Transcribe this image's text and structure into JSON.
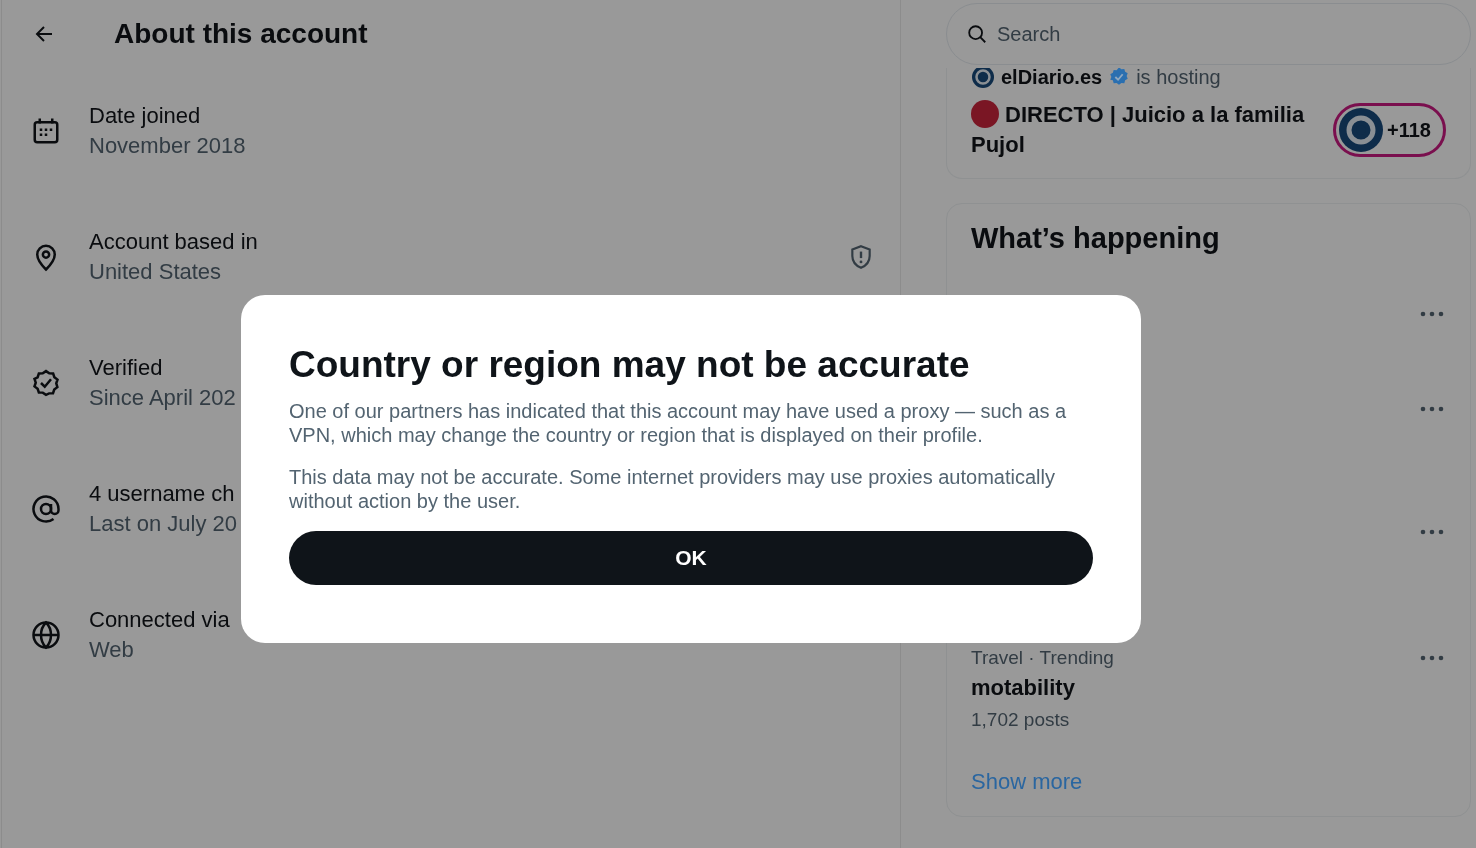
{
  "header": {
    "title": "About this account"
  },
  "details": [
    {
      "kind": "calendar",
      "label": "Date joined",
      "value": "November 2018"
    },
    {
      "kind": "location",
      "label": "Account based in",
      "value": "United States",
      "shield": true
    },
    {
      "kind": "verified",
      "label": "Verified",
      "value": "Since April 202"
    },
    {
      "kind": "at",
      "label": "4 username ch",
      "value": "Last on July 20"
    },
    {
      "kind": "globe",
      "label": "Connected via",
      "value": "Web"
    }
  ],
  "search": {
    "placeholder": "Search"
  },
  "live": {
    "host": "elDiario.es",
    "host_verified": true,
    "hosting": "is hosting",
    "title": "DIRECTO | Juicio a la familia Pujol",
    "listeners": "+118"
  },
  "trends": {
    "title": "What’s happening",
    "items": [
      {
        "category": "Travel · Trending",
        "topic": "motability",
        "posts": "1,702 posts"
      }
    ],
    "show_more": "Show more"
  },
  "dialog": {
    "title": "Country or region may not be accurate",
    "paragraphs": [
      "One of our partners has indicated that this account may have used a proxy — such as a VPN, which may change the country or region that is displayed on their profile.",
      "This data may not be accurate. Some internet providers may use proxies automatically without action by the user."
    ],
    "button": "OK"
  }
}
